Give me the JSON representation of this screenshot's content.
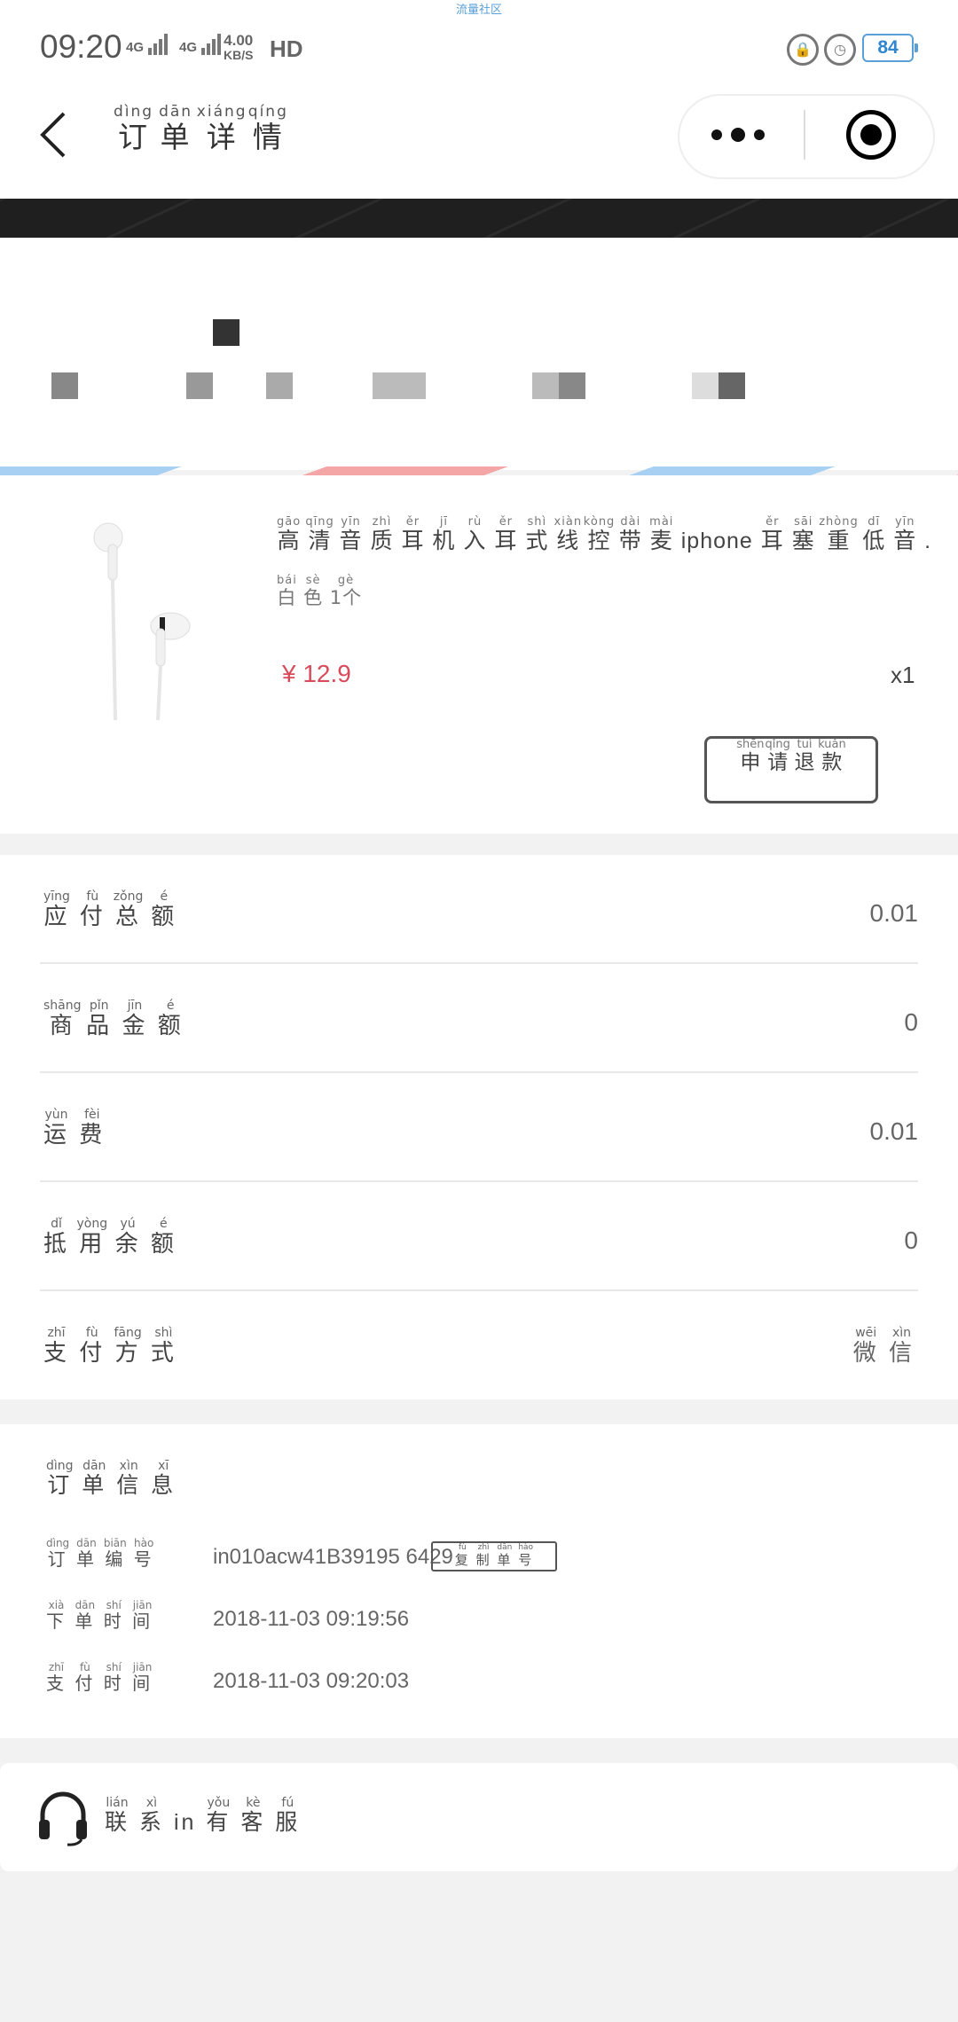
{
  "status_bar": {
    "top_caption": "流量社区",
    "time": "09:20",
    "net1": "4G",
    "net2": "4G",
    "speed_value": "4.00",
    "speed_unit": "KB/S",
    "hd": "HD",
    "battery": "84"
  },
  "header": {
    "title_chars": [
      {
        "char": "订",
        "pinyin": "dìng"
      },
      {
        "char": "单",
        "pinyin": "dān"
      },
      {
        "char": "详",
        "pinyin": "xiáng"
      },
      {
        "char": "情",
        "pinyin": "qíng"
      }
    ]
  },
  "product": {
    "name_pinyin_chars": [
      {
        "char": "高",
        "pinyin": "gāo"
      },
      {
        "char": "清",
        "pinyin": "qīng"
      },
      {
        "char": "音",
        "pinyin": "yīn"
      },
      {
        "char": "质",
        "pinyin": "zhì"
      },
      {
        "char": "耳",
        "pinyin": "ěr"
      },
      {
        "char": "机",
        "pinyin": "jī"
      },
      {
        "char": "入",
        "pinyin": "rù"
      },
      {
        "char": "耳",
        "pinyin": "ěr"
      },
      {
        "char": "式",
        "pinyin": "shì"
      },
      {
        "char": "线",
        "pinyin": "xiàn"
      },
      {
        "char": "控",
        "pinyin": "kòng"
      },
      {
        "char": "带",
        "pinyin": "dài"
      },
      {
        "char": "麦",
        "pinyin": "mài"
      }
    ],
    "name_mid": "iphone",
    "name_tail_chars": [
      {
        "char": "耳",
        "pinyin": "ěr"
      },
      {
        "char": "塞",
        "pinyin": "sāi"
      },
      {
        "char": "重",
        "pinyin": "zhòng"
      },
      {
        "char": "低",
        "pinyin": "dī"
      },
      {
        "char": "音",
        "pinyin": "yīn"
      }
    ],
    "name_end": ".",
    "spec_chars": [
      {
        "char": "白",
        "pinyin": "bái"
      },
      {
        "char": "色",
        "pinyin": "sè"
      },
      {
        "char": "1个",
        "pinyin": "gè"
      }
    ],
    "price": "¥ 12.9",
    "qty": "x1",
    "refund_chars": [
      {
        "char": "申",
        "pinyin": "shēn"
      },
      {
        "char": "请",
        "pinyin": "qǐng"
      },
      {
        "char": "退",
        "pinyin": "tuì"
      },
      {
        "char": "款",
        "pinyin": "kuǎn"
      }
    ]
  },
  "summary": {
    "rows": [
      {
        "chars": [
          {
            "char": "应",
            "pinyin": "yīng"
          },
          {
            "char": "付",
            "pinyin": "fù"
          },
          {
            "char": "总",
            "pinyin": "zǒng"
          },
          {
            "char": "额",
            "pinyin": "é"
          }
        ],
        "value": "0.01"
      },
      {
        "chars": [
          {
            "char": "商",
            "pinyin": "shāng"
          },
          {
            "char": "品",
            "pinyin": "pǐn"
          },
          {
            "char": "金",
            "pinyin": "jīn"
          },
          {
            "char": "额",
            "pinyin": "é"
          }
        ],
        "value": "0"
      },
      {
        "chars": [
          {
            "char": "运",
            "pinyin": "yùn"
          },
          {
            "char": "费",
            "pinyin": "fèi"
          }
        ],
        "value": "0.01"
      },
      {
        "chars": [
          {
            "char": "抵",
            "pinyin": "dǐ"
          },
          {
            "char": "用",
            "pinyin": "yòng"
          },
          {
            "char": "余",
            "pinyin": "yú"
          },
          {
            "char": "额",
            "pinyin": "é"
          }
        ],
        "value": "0"
      },
      {
        "chars": [
          {
            "char": "支",
            "pinyin": "zhī"
          },
          {
            "char": "付",
            "pinyin": "fù"
          },
          {
            "char": "方",
            "pinyin": "fāng"
          },
          {
            "char": "式",
            "pinyin": "shì"
          }
        ],
        "value_chars": [
          {
            "char": "微",
            "pinyin": "wēi"
          },
          {
            "char": "信",
            "pinyin": "xìn"
          }
        ]
      }
    ]
  },
  "order_info": {
    "title_chars": [
      {
        "char": "订",
        "pinyin": "dìng"
      },
      {
        "char": "单",
        "pinyin": "dān"
      },
      {
        "char": "信",
        "pinyin": "xìn"
      },
      {
        "char": "息",
        "pinyin": "xī"
      }
    ],
    "number_label": [
      {
        "char": "订",
        "pinyin": "dìng"
      },
      {
        "char": "单",
        "pinyin": "dān"
      },
      {
        "char": "编",
        "pinyin": "biān"
      },
      {
        "char": "号",
        "pinyin": "hào"
      }
    ],
    "number_value": "in010acw41B39195 6429",
    "copy_chars": [
      {
        "char": "复",
        "pinyin": "fù"
      },
      {
        "char": "制",
        "pinyin": "zhì"
      },
      {
        "char": "单",
        "pinyin": "dān"
      },
      {
        "char": "号",
        "pinyin": "hào"
      }
    ],
    "order_time_label": [
      {
        "char": "下",
        "pinyin": "xià"
      },
      {
        "char": "单",
        "pinyin": "dān"
      },
      {
        "char": "时",
        "pinyin": "shí"
      },
      {
        "char": "间",
        "pinyin": "jiān"
      }
    ],
    "order_time_value": "2018-11-03 09:19:56",
    "pay_time_label": [
      {
        "char": "支",
        "pinyin": "zhī"
      },
      {
        "char": "付",
        "pinyin": "fù"
      },
      {
        "char": "时",
        "pinyin": "shí"
      },
      {
        "char": "间",
        "pinyin": "jiān"
      }
    ],
    "pay_time_value": "2018-11-03 09:20:03"
  },
  "contact": {
    "chars_a": [
      {
        "char": "联",
        "pinyin": "lián"
      },
      {
        "char": "系",
        "pinyin": "xì"
      }
    ],
    "mid": "in",
    "chars_b": [
      {
        "char": "有",
        "pinyin": "yǒu"
      },
      {
        "char": "客",
        "pinyin": "kè"
      },
      {
        "char": "服",
        "pinyin": "fú"
      }
    ]
  },
  "colors": {
    "price": "#d84b5a",
    "battery": "#2f86d1",
    "background": "#f2f2f2"
  }
}
